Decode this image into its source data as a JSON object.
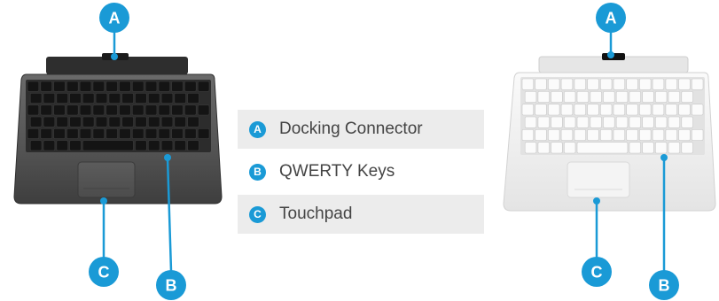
{
  "colors": {
    "accent": "#1a9ad6",
    "legend_shade": "#ececec",
    "legend_text": "#444444",
    "dark_keyboard": "#4a4a4a",
    "light_keyboard": "#eeeeee"
  },
  "legend": [
    {
      "badge": "A",
      "label": "Docking Connector"
    },
    {
      "badge": "B",
      "label": "QWERTY Keys"
    },
    {
      "badge": "C",
      "label": "Touchpad"
    }
  ],
  "dark_keyboard": {
    "callouts": {
      "a": "A",
      "b": "B",
      "c": "C"
    }
  },
  "light_keyboard": {
    "callouts": {
      "a": "A",
      "b": "B",
      "c": "C"
    }
  }
}
